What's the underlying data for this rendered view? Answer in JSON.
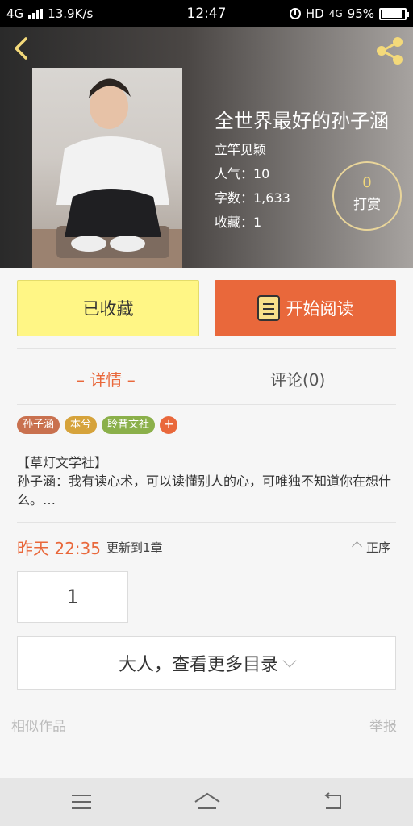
{
  "status_bar": {
    "network": "4G",
    "speed": "13.9K/s",
    "time": "12:47",
    "hd": "HD",
    "network2": "4G",
    "battery": "95%"
  },
  "book": {
    "title": "全世界最好的孙子涵",
    "author": "立竿见颖",
    "popularity": "人气：10",
    "word_count": "字数：1,633",
    "favorites": "收藏：1",
    "reward_count": "0",
    "reward_label": "打赏"
  },
  "actions": {
    "collected_label": "已收藏",
    "read_label": "开始阅读"
  },
  "tabs": {
    "detail": "– 详情 –",
    "comment": "评论(0)"
  },
  "tags": [
    {
      "label": "孙子涵",
      "color": "#c9714f"
    },
    {
      "label": "本兮",
      "color": "#d6a33b"
    },
    {
      "label": "聆昔文社",
      "color": "#8bb04a"
    }
  ],
  "tag_add": "+",
  "description": {
    "line1": "【草灯文学社】",
    "line2": "孙子涵：我有读心术，可以读懂别人的心，可唯独不知道你在想什么。…"
  },
  "update": {
    "time": "昨天 22:35",
    "text": "更新到1章",
    "sort": "正序"
  },
  "chapter": {
    "number": "1",
    "more": "大人，查看更多目录"
  },
  "footer": {
    "similar": "相似作品",
    "report": "举报"
  },
  "colors": {
    "accent": "#e9683b",
    "collected_bg": "#fff685"
  }
}
